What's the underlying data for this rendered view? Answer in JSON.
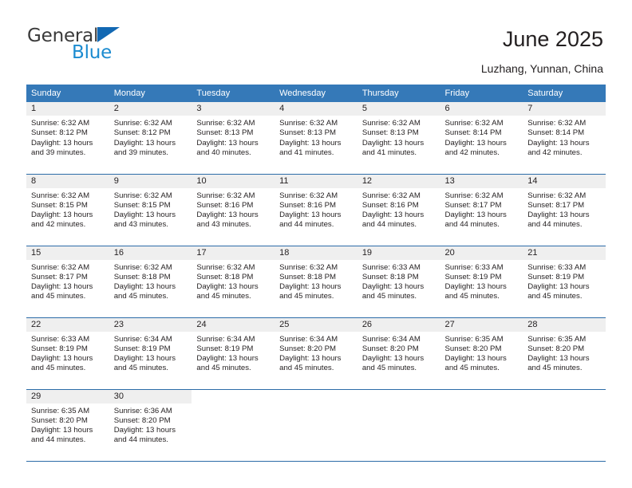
{
  "brand": {
    "name_part1": "General",
    "name_part2": "Blue",
    "logo_icon": "triangle-logo-icon",
    "accent_color": "#1268b3",
    "blue_text_color": "#1b8bd0"
  },
  "header": {
    "title": "June 2025",
    "location": "Luzhang, Yunnan, China"
  },
  "calendar": {
    "header_bg": "#3579b8",
    "daynum_bg": "#efefef",
    "weekdays": [
      "Sunday",
      "Monday",
      "Tuesday",
      "Wednesday",
      "Thursday",
      "Friday",
      "Saturday"
    ],
    "weeks": [
      [
        {
          "day": "1",
          "sunrise": "Sunrise: 6:32 AM",
          "sunset": "Sunset: 8:12 PM",
          "daylight1": "Daylight: 13 hours",
          "daylight2": "and 39 minutes."
        },
        {
          "day": "2",
          "sunrise": "Sunrise: 6:32 AM",
          "sunset": "Sunset: 8:12 PM",
          "daylight1": "Daylight: 13 hours",
          "daylight2": "and 39 minutes."
        },
        {
          "day": "3",
          "sunrise": "Sunrise: 6:32 AM",
          "sunset": "Sunset: 8:13 PM",
          "daylight1": "Daylight: 13 hours",
          "daylight2": "and 40 minutes."
        },
        {
          "day": "4",
          "sunrise": "Sunrise: 6:32 AM",
          "sunset": "Sunset: 8:13 PM",
          "daylight1": "Daylight: 13 hours",
          "daylight2": "and 41 minutes."
        },
        {
          "day": "5",
          "sunrise": "Sunrise: 6:32 AM",
          "sunset": "Sunset: 8:13 PM",
          "daylight1": "Daylight: 13 hours",
          "daylight2": "and 41 minutes."
        },
        {
          "day": "6",
          "sunrise": "Sunrise: 6:32 AM",
          "sunset": "Sunset: 8:14 PM",
          "daylight1": "Daylight: 13 hours",
          "daylight2": "and 42 minutes."
        },
        {
          "day": "7",
          "sunrise": "Sunrise: 6:32 AM",
          "sunset": "Sunset: 8:14 PM",
          "daylight1": "Daylight: 13 hours",
          "daylight2": "and 42 minutes."
        }
      ],
      [
        {
          "day": "8",
          "sunrise": "Sunrise: 6:32 AM",
          "sunset": "Sunset: 8:15 PM",
          "daylight1": "Daylight: 13 hours",
          "daylight2": "and 42 minutes."
        },
        {
          "day": "9",
          "sunrise": "Sunrise: 6:32 AM",
          "sunset": "Sunset: 8:15 PM",
          "daylight1": "Daylight: 13 hours",
          "daylight2": "and 43 minutes."
        },
        {
          "day": "10",
          "sunrise": "Sunrise: 6:32 AM",
          "sunset": "Sunset: 8:16 PM",
          "daylight1": "Daylight: 13 hours",
          "daylight2": "and 43 minutes."
        },
        {
          "day": "11",
          "sunrise": "Sunrise: 6:32 AM",
          "sunset": "Sunset: 8:16 PM",
          "daylight1": "Daylight: 13 hours",
          "daylight2": "and 44 minutes."
        },
        {
          "day": "12",
          "sunrise": "Sunrise: 6:32 AM",
          "sunset": "Sunset: 8:16 PM",
          "daylight1": "Daylight: 13 hours",
          "daylight2": "and 44 minutes."
        },
        {
          "day": "13",
          "sunrise": "Sunrise: 6:32 AM",
          "sunset": "Sunset: 8:17 PM",
          "daylight1": "Daylight: 13 hours",
          "daylight2": "and 44 minutes."
        },
        {
          "day": "14",
          "sunrise": "Sunrise: 6:32 AM",
          "sunset": "Sunset: 8:17 PM",
          "daylight1": "Daylight: 13 hours",
          "daylight2": "and 44 minutes."
        }
      ],
      [
        {
          "day": "15",
          "sunrise": "Sunrise: 6:32 AM",
          "sunset": "Sunset: 8:17 PM",
          "daylight1": "Daylight: 13 hours",
          "daylight2": "and 45 minutes."
        },
        {
          "day": "16",
          "sunrise": "Sunrise: 6:32 AM",
          "sunset": "Sunset: 8:18 PM",
          "daylight1": "Daylight: 13 hours",
          "daylight2": "and 45 minutes."
        },
        {
          "day": "17",
          "sunrise": "Sunrise: 6:32 AM",
          "sunset": "Sunset: 8:18 PM",
          "daylight1": "Daylight: 13 hours",
          "daylight2": "and 45 minutes."
        },
        {
          "day": "18",
          "sunrise": "Sunrise: 6:32 AM",
          "sunset": "Sunset: 8:18 PM",
          "daylight1": "Daylight: 13 hours",
          "daylight2": "and 45 minutes."
        },
        {
          "day": "19",
          "sunrise": "Sunrise: 6:33 AM",
          "sunset": "Sunset: 8:18 PM",
          "daylight1": "Daylight: 13 hours",
          "daylight2": "and 45 minutes."
        },
        {
          "day": "20",
          "sunrise": "Sunrise: 6:33 AM",
          "sunset": "Sunset: 8:19 PM",
          "daylight1": "Daylight: 13 hours",
          "daylight2": "and 45 minutes."
        },
        {
          "day": "21",
          "sunrise": "Sunrise: 6:33 AM",
          "sunset": "Sunset: 8:19 PM",
          "daylight1": "Daylight: 13 hours",
          "daylight2": "and 45 minutes."
        }
      ],
      [
        {
          "day": "22",
          "sunrise": "Sunrise: 6:33 AM",
          "sunset": "Sunset: 8:19 PM",
          "daylight1": "Daylight: 13 hours",
          "daylight2": "and 45 minutes."
        },
        {
          "day": "23",
          "sunrise": "Sunrise: 6:34 AM",
          "sunset": "Sunset: 8:19 PM",
          "daylight1": "Daylight: 13 hours",
          "daylight2": "and 45 minutes."
        },
        {
          "day": "24",
          "sunrise": "Sunrise: 6:34 AM",
          "sunset": "Sunset: 8:19 PM",
          "daylight1": "Daylight: 13 hours",
          "daylight2": "and 45 minutes."
        },
        {
          "day": "25",
          "sunrise": "Sunrise: 6:34 AM",
          "sunset": "Sunset: 8:20 PM",
          "daylight1": "Daylight: 13 hours",
          "daylight2": "and 45 minutes."
        },
        {
          "day": "26",
          "sunrise": "Sunrise: 6:34 AM",
          "sunset": "Sunset: 8:20 PM",
          "daylight1": "Daylight: 13 hours",
          "daylight2": "and 45 minutes."
        },
        {
          "day": "27",
          "sunrise": "Sunrise: 6:35 AM",
          "sunset": "Sunset: 8:20 PM",
          "daylight1": "Daylight: 13 hours",
          "daylight2": "and 45 minutes."
        },
        {
          "day": "28",
          "sunrise": "Sunrise: 6:35 AM",
          "sunset": "Sunset: 8:20 PM",
          "daylight1": "Daylight: 13 hours",
          "daylight2": "and 45 minutes."
        }
      ],
      [
        {
          "day": "29",
          "sunrise": "Sunrise: 6:35 AM",
          "sunset": "Sunset: 8:20 PM",
          "daylight1": "Daylight: 13 hours",
          "daylight2": "and 44 minutes."
        },
        {
          "day": "30",
          "sunrise": "Sunrise: 6:36 AM",
          "sunset": "Sunset: 8:20 PM",
          "daylight1": "Daylight: 13 hours",
          "daylight2": "and 44 minutes."
        },
        {
          "day": "",
          "sunrise": "",
          "sunset": "",
          "daylight1": "",
          "daylight2": ""
        },
        {
          "day": "",
          "sunrise": "",
          "sunset": "",
          "daylight1": "",
          "daylight2": ""
        },
        {
          "day": "",
          "sunrise": "",
          "sunset": "",
          "daylight1": "",
          "daylight2": ""
        },
        {
          "day": "",
          "sunrise": "",
          "sunset": "",
          "daylight1": "",
          "daylight2": ""
        },
        {
          "day": "",
          "sunrise": "",
          "sunset": "",
          "daylight1": "",
          "daylight2": ""
        }
      ]
    ]
  }
}
